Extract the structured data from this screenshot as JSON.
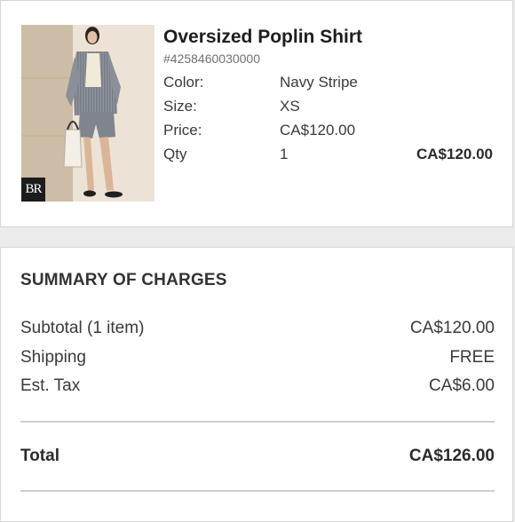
{
  "product": {
    "name": "Oversized Poplin Shirt",
    "sku": "#4258460030000",
    "image_alt": "Model wearing striped oversized poplin shirt and shorts",
    "brand_logo_icon": "br-monogram-icon",
    "attributes": [
      {
        "label": "Color:",
        "value": "Navy Stripe"
      },
      {
        "label": "Size:",
        "value": "XS"
      },
      {
        "label": "Price:",
        "value": "CA$120.00"
      },
      {
        "label": "Qty",
        "value": "1"
      }
    ],
    "line_total": "CA$120.00"
  },
  "summary": {
    "title": "SUMMARY OF CHARGES",
    "rows": [
      {
        "label": "Subtotal (1 item)",
        "value": "CA$120.00"
      },
      {
        "label": "Shipping",
        "value": "FREE"
      },
      {
        "label": "Est. Tax",
        "value": "CA$6.00"
      }
    ],
    "total_label": "Total",
    "total_value": "CA$126.00"
  },
  "colors": {
    "background": "#ebebeb",
    "card": "#ffffff",
    "text": "#2b2b2b",
    "muted": "#6f6f6f",
    "divider": "#cfcfcf"
  }
}
